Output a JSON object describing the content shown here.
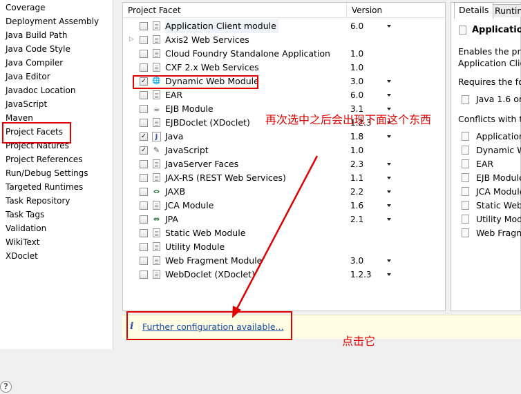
{
  "left_nav": {
    "items": [
      "Coverage",
      "Deployment Assembly",
      "Java Build Path",
      "Java Code Style",
      "Java Compiler",
      "Java Editor",
      "Javadoc Location",
      "JavaScript",
      "Maven",
      "Project Facets",
      "Project Natures",
      "Project References",
      "Run/Debug Settings",
      "Targeted Runtimes",
      "Task Repository",
      "Task Tags",
      "Validation",
      "WikiText",
      "XDoclet"
    ]
  },
  "facets_table": {
    "headers": {
      "facet": "Project Facet",
      "version": "Version"
    },
    "rows": [
      {
        "name": "Application Client module",
        "version": "6.0",
        "checked": false,
        "has_dropdown": true,
        "icon": "document-icon",
        "selected": true
      },
      {
        "name": "Axis2 Web Services",
        "version": "",
        "checked": false,
        "has_dropdown": false,
        "icon": "document-icon",
        "expandable": true
      },
      {
        "name": "Cloud Foundry Standalone Application",
        "version": "1.0",
        "checked": false,
        "has_dropdown": false,
        "icon": "document-icon"
      },
      {
        "name": "CXF 2.x Web Services",
        "version": "1.0",
        "checked": false,
        "has_dropdown": false,
        "icon": "document-icon"
      },
      {
        "name": "Dynamic Web Module",
        "version": "3.0",
        "checked": true,
        "has_dropdown": true,
        "icon": "globe-icon"
      },
      {
        "name": "EAR",
        "version": "6.0",
        "checked": false,
        "has_dropdown": true,
        "icon": "document-icon"
      },
      {
        "name": "EJB Module",
        "version": "3.1",
        "checked": false,
        "has_dropdown": true,
        "icon": "bean-icon"
      },
      {
        "name": "EJBDoclet (XDoclet)",
        "version": "1.2.3",
        "checked": false,
        "has_dropdown": true,
        "icon": "document-icon"
      },
      {
        "name": "Java",
        "version": "1.8",
        "checked": true,
        "has_dropdown": true,
        "icon": "java-icon"
      },
      {
        "name": "JavaScript",
        "version": "1.0",
        "checked": true,
        "has_dropdown": false,
        "icon": "javascript-icon"
      },
      {
        "name": "JavaServer Faces",
        "version": "2.3",
        "checked": false,
        "has_dropdown": true,
        "icon": "document-icon"
      },
      {
        "name": "JAX-RS (REST Web Services)",
        "version": "1.1",
        "checked": false,
        "has_dropdown": true,
        "icon": "document-icon"
      },
      {
        "name": "JAXB",
        "version": "2.2",
        "checked": false,
        "has_dropdown": true,
        "icon": "jaxb-icon"
      },
      {
        "name": "JCA Module",
        "version": "1.6",
        "checked": false,
        "has_dropdown": true,
        "icon": "document-icon"
      },
      {
        "name": "JPA",
        "version": "2.1",
        "checked": false,
        "has_dropdown": true,
        "icon": "jpa-icon"
      },
      {
        "name": "Static Web Module",
        "version": "",
        "checked": false,
        "has_dropdown": false,
        "icon": "document-icon"
      },
      {
        "name": "Utility Module",
        "version": "",
        "checked": false,
        "has_dropdown": false,
        "icon": "document-icon"
      },
      {
        "name": "Web Fragment Module",
        "version": "3.0",
        "checked": false,
        "has_dropdown": true,
        "icon": "document-icon"
      },
      {
        "name": "WebDoclet (XDoclet)",
        "version": "1.2.3",
        "checked": false,
        "has_dropdown": true,
        "icon": "document-icon"
      }
    ]
  },
  "config_bar": {
    "info_icon": "i",
    "link_text": "Further configuration available..."
  },
  "details_panel": {
    "tabs": [
      "Details",
      "Runtim"
    ],
    "title": "Application",
    "desc_line1": "Enables the pro",
    "desc_line2": "Application Clie",
    "requires_label": "Requires the fol",
    "requires_item": "Java 1.6 or",
    "conflicts_label": "Conflicts with th",
    "conflicts": [
      "Application",
      "Dynamic W",
      "EAR",
      "EJB Module",
      "JCA Module",
      "Static Web",
      "Utility Mod",
      "Web Fragm"
    ]
  },
  "annotations": {
    "note_top": "再次选中之后会出现下面这个东西",
    "note_bottom": "点击它"
  },
  "colors": {
    "annotation_red": "#e00000",
    "link_blue": "#1446a8",
    "config_bar_bg": "#fffde3"
  }
}
